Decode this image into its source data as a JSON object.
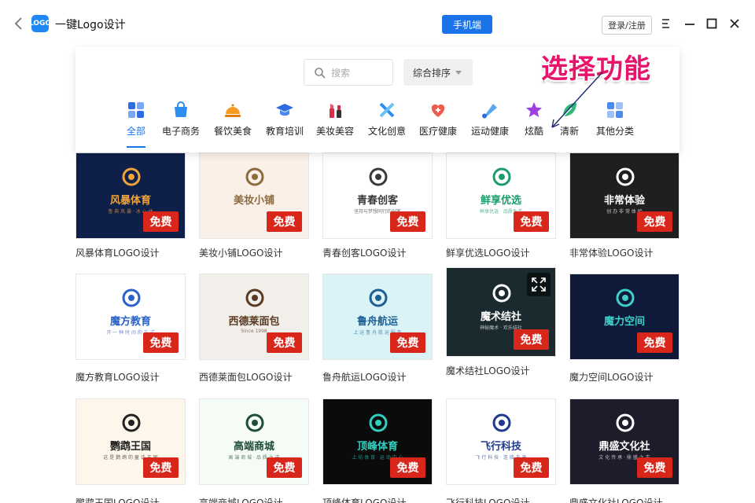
{
  "app": {
    "title": "一键Logo设计",
    "logo_text": "LOGO"
  },
  "titlebar": {
    "phone_label": "手机端",
    "login_label": "登录/注册"
  },
  "search": {
    "placeholder": "搜索",
    "value": ""
  },
  "sort": {
    "label": "综合排序"
  },
  "categories": [
    {
      "label": "全部",
      "icon": "grid-icon",
      "active": true
    },
    {
      "label": "电子商务",
      "icon": "shopping-bag-icon"
    },
    {
      "label": "餐饮美食",
      "icon": "food-cover-icon"
    },
    {
      "label": "教育培训",
      "icon": "graduation-cap-icon"
    },
    {
      "label": "美妆美容",
      "icon": "lipstick-icon"
    },
    {
      "label": "文化创意",
      "icon": "creative-tools-icon"
    },
    {
      "label": "医疗健康",
      "icon": "medical-heart-icon"
    },
    {
      "label": "运动健康",
      "icon": "badminton-icon"
    },
    {
      "label": "炫酷",
      "icon": "star-icon"
    },
    {
      "label": "清新",
      "icon": "leaf-icon"
    },
    {
      "label": "其他分类",
      "icon": "more-grid-icon"
    }
  ],
  "callout": {
    "text": "选择功能"
  },
  "free_label": "免费",
  "templates": [
    {
      "name": "风暴体育LOGO设计",
      "logo_text": "风暴体育",
      "sub": "鲁 典 风 暴 · 冰 心 体",
      "bg": "#0e1f4a",
      "fg": "#f2a33a"
    },
    {
      "name": "美妆小铺LOGO设计",
      "logo_text": "美妆小铺",
      "sub": "",
      "bg": "#fbf0e8",
      "fg": "#8c6b3d"
    },
    {
      "name": "青春创客LOGO设计",
      "logo_text": "青春创客",
      "sub": "坚持与梦想同行的创客",
      "bg": "#ffffff",
      "fg": "#3a3a3a"
    },
    {
      "name": "鲜享优选LOGO设计",
      "logo_text": "鲜享优选",
      "sub": "鲜享优选 · 品质生活",
      "bg": "#ffffff",
      "fg": "#1b9c6b"
    },
    {
      "name": "非常体验LOGO设计",
      "logo_text": "非常体验",
      "sub": "创 办 非 常 体 验",
      "bg": "#1f1f1f",
      "fg": "#ffffff"
    },
    {
      "name": "魔方教育LOGO设计",
      "logo_text": "魔方教育",
      "sub": "开 一 种 时 间 的 方 式",
      "bg": "#ffffff",
      "fg": "#2a62c9"
    },
    {
      "name": "西德莱面包LOGO设计",
      "logo_text": "西德莱面包",
      "sub": "Since 1998",
      "bg": "#f2efea",
      "fg": "#5a3a22"
    },
    {
      "name": "鲁舟航运LOGO设计",
      "logo_text": "鲁舟航运",
      "sub": "上 运 鲁 舟 航 运 服 务",
      "bg": "#d9f3f7",
      "fg": "#1e5f93"
    },
    {
      "name": "魔术结社LOGO设计",
      "logo_text": "魔术结社",
      "sub": "神秘魔术 · 欢乐结社",
      "bg": "#1b2a2e",
      "fg": "#ffffff"
    },
    {
      "name": "魔力空间LOGO设计",
      "logo_text": "魔力空间",
      "sub": "",
      "bg": "#0f1a3a",
      "fg": "#3fd0c9"
    },
    {
      "name": "鹦鹉王国LOGO设计",
      "logo_text": "鹦鹉王国",
      "sub": "这 是 鹦 鹉 的 童 话 王 国",
      "bg": "#fdf6ea",
      "fg": "#222222"
    },
    {
      "name": "高端商城LOGO设计",
      "logo_text": "高端商城",
      "sub": "高 端 商 城 · 品 质 之 选",
      "bg": "#f5fbf5",
      "fg": "#1e4d3a"
    },
    {
      "name": "顶峰体育LOGO设计",
      "logo_text": "顶峰体育",
      "sub": "上 坊 体 育 · 运 动 中 心",
      "bg": "#0b0b0b",
      "fg": "#2fd0c0"
    },
    {
      "name": "飞行科技LOGO设计",
      "logo_text": "飞行科技",
      "sub": "飞 行 科 技 · 连 接 未 来",
      "bg": "#ffffff",
      "fg": "#1f3c8c"
    },
    {
      "name": "鼎盛文化社LOGO设计",
      "logo_text": "鼎盛文化社",
      "sub": "文 化 传 承 · 鼎 盛 之 志",
      "bg": "#1c1c2a",
      "fg": "#ffffff"
    }
  ],
  "colors": {
    "accent": "#1a73e8",
    "free_badge": "#d8261b",
    "callout": "#e6156b"
  }
}
